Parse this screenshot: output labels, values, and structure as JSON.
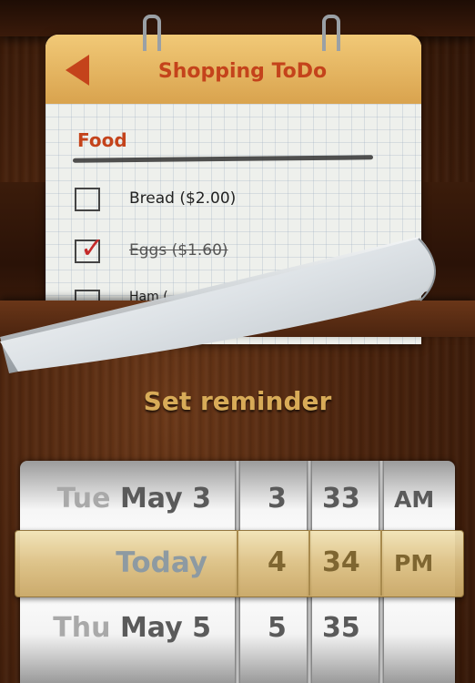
{
  "notepad": {
    "title": "Shopping ToDo",
    "back_icon": "back-arrow-icon",
    "section": "Food",
    "items": [
      {
        "label": "Bread ($2.00)",
        "checked": false
      },
      {
        "label": "Eggs ($1.60)",
        "checked": true
      },
      {
        "label": "Ham (",
        "checked": false
      }
    ]
  },
  "reminder": {
    "title": "Set reminder"
  },
  "picker": {
    "rows": [
      {
        "day": "Tue",
        "date": "May 3",
        "hour": "3",
        "minute": "33",
        "ampm": "AM"
      },
      {
        "day": "",
        "date": "Today",
        "hour": "4",
        "minute": "34",
        "ampm": "PM"
      },
      {
        "day": "Thu",
        "date": "May 5",
        "hour": "5",
        "minute": "35",
        "ampm": ""
      }
    ]
  },
  "colors": {
    "accent_red": "#c4431b",
    "header_gold": "#d9a34e",
    "reminder_title": "#d8ab58",
    "selection_bar": "#dcc083"
  }
}
